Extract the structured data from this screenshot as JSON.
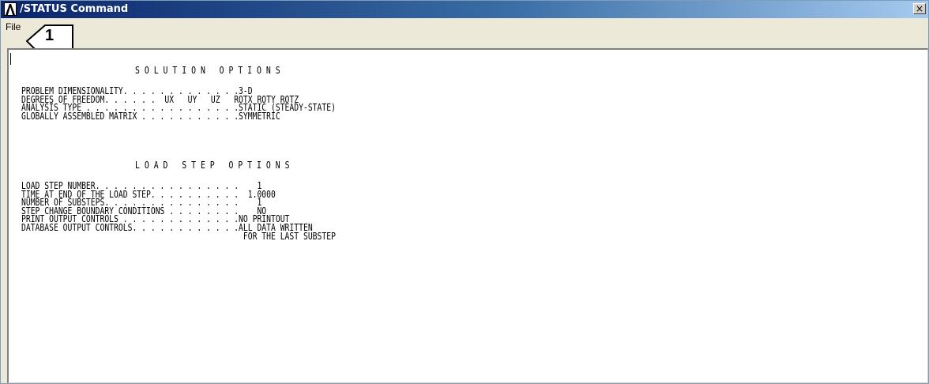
{
  "window": {
    "title": "/STATUS Command",
    "close_symbol": "×",
    "icon": "ansys-logo-icon"
  },
  "menu": {
    "file_label": "File"
  },
  "callout": {
    "label": "1"
  },
  "report": {
    "solution_heading": "S O L U T I O N   O P T I O N S",
    "solution_lines": [
      "PROBLEM DIMENSIONALITY. . . . . . . . . . . . .3-D",
      "DEGREES OF FREEDOM. . . . . .  UX   UY   UZ   ROTX ROTY ROTZ",
      "ANALYSIS TYPE . . . . . . . . . . . . . . . . .STATIC (STEADY-STATE)",
      "GLOBALLY ASSEMBLED MATRIX . . . . . . . . . . .SYMMETRIC"
    ],
    "load_heading": "L O A D   S T E P   O P T I O N S",
    "load_lines": [
      "LOAD STEP NUMBER. . . . . . . . . . . . . . . .    1",
      "TIME AT END OF THE LOAD STEP. . . . . . . . . .  1.0000",
      "NUMBER OF SUBSTEPS. . . . . . . . . . . . . . .    1",
      "STEP CHANGE BOUNDARY CONDITIONS . . . . . . . .    NO",
      "PRINT OUTPUT CONTROLS . . . . . . . . . . . . .NO PRINTOUT",
      "DATABASE OUTPUT CONTROLS. . . . . . . . . . . .ALL DATA WRITTEN",
      "                                                FOR THE LAST SUBSTEP"
    ]
  },
  "colors": {
    "titlebar_start": "#0a246a",
    "titlebar_end": "#a6caf0",
    "window_face": "#ece9d8",
    "text_area": "#ffffff"
  }
}
